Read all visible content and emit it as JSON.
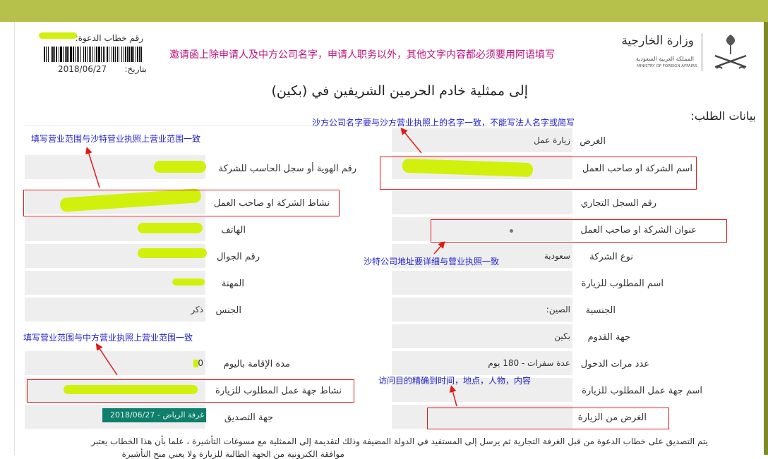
{
  "header": {
    "invite_number_label": "رقم خطاب الدعوة:",
    "date_label": "بتاريخ:",
    "date_value": "2018/06/27",
    "ministry_ar": "وزارة الخارجية",
    "ministry_sub_ar": "المملكة العربية السعودية",
    "ministry_en": "MINISTRY OF FOREIGN AFFAIRS",
    "top_note": "邀请函上除申请人及中方公司名字，申请人职务以外，其他文字内容都必须要用阿语填写"
  },
  "title": "إلى ممثلية خادم الحرمين الشريفين في (بكين)",
  "section_title": "بيانات الطلب:",
  "right_col": [
    {
      "label": "الغرض",
      "value": "زيارة عمل"
    },
    {
      "label": "اسم الشركة او صاحب العمل",
      "value": ""
    },
    {
      "label": "رقم السجل التجاري",
      "value": ""
    },
    {
      "label": "عنوان الشركة او صاحب العمل",
      "value": ""
    },
    {
      "label": "نوع الشركة",
      "value": "سعودية"
    },
    {
      "label": "اسم المطلوب للزيارة",
      "value": ""
    },
    {
      "label": "الجنسية",
      "value": "الصين:"
    },
    {
      "label": "جهة القدوم",
      "value": "بكين"
    },
    {
      "label": "عدد مرات الدخول",
      "value": "عدة سفرات - 180 يوم"
    },
    {
      "label": "اسم جهة عمل المطلوب للزيارة",
      "value": ""
    },
    {
      "label": "الغرض من الزيارة",
      "value": ""
    }
  ],
  "left_col": [
    {
      "label": "رقم الهوية أو سجل الحاسب للشركة",
      "value": ""
    },
    {
      "label": "نشاط الشركة او صاحب العمل",
      "value": ""
    },
    {
      "label": "الهاتف",
      "value": ""
    },
    {
      "label": "رقم الجوال",
      "value": ""
    },
    {
      "label": "المهنة",
      "value": ""
    },
    {
      "label": "الجنس",
      "value": "ذكر"
    },
    {
      "label": "مدة الإقامة باليوم",
      "value": "0"
    },
    {
      "label": "نشاط جهة عمل المطلوب للزيارة",
      "value": ""
    },
    {
      "label": "جهة التصديق",
      "value": "غرفة الرياض - 2018/06/27"
    }
  ],
  "notes": {
    "company_name": "沙方公司名字要与沙方营业执照上的名字一致，不能写法人名字或简写",
    "business_scope_saudi": "填写营业范围与沙特营业执照上营业范围一致",
    "address": "沙特公司地址要详细与营业执照一致",
    "business_scope_china": "填写营业范围与中方营业执照上营业范围一致",
    "purpose": "访问目的精确到时间，地点，人物，内容"
  },
  "footer": {
    "line1": "يتم التصديق على خطاب الدعوة من قبل الغرفة التجارية ثم يرسل إلى المستفيد في الدولة المضيفة وذلك لتقديمة إلى الممثلية مع مسوغات التأشيرة ، علما بأن هذا الخطاب يعتبر",
    "line2": "موافقة الكترونية من الجهة الطالبة للزيارة ولا يعني منح التأشيرة"
  },
  "colors": {
    "topbar": "#b5c14b",
    "field_bg": "#eeeeee",
    "annotation_red": "#e01a1a",
    "annotation_blue": "#1f1fd0",
    "redaction": "#cff000",
    "stamp_bg": "#0d7f6b"
  }
}
